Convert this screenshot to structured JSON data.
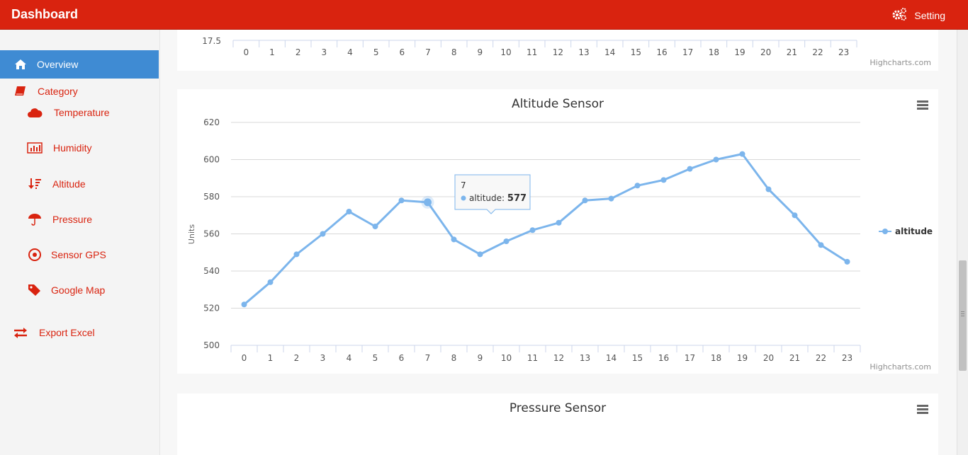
{
  "app": {
    "title": "Dashboard",
    "setting_label": "Setting"
  },
  "sidebar": {
    "items": [
      {
        "label": "Overview",
        "icon": "home-icon"
      },
      {
        "label": "Category",
        "icon": "book-icon"
      },
      {
        "label": "Temperature",
        "icon": "cloud-icon"
      },
      {
        "label": "Humidity",
        "icon": "bar-chart-icon"
      },
      {
        "label": "Altitude",
        "icon": "sort-icon"
      },
      {
        "label": "Pressure",
        "icon": "umbrella-icon"
      },
      {
        "label": "Sensor GPS",
        "icon": "target-icon"
      },
      {
        "label": "Google Map",
        "icon": "tag-icon"
      },
      {
        "label": "Export Excel",
        "icon": "exchange-icon"
      }
    ]
  },
  "top_chart": {
    "ytick": "17.5",
    "categories": [
      "0",
      "1",
      "2",
      "3",
      "4",
      "5",
      "6",
      "7",
      "8",
      "9",
      "10",
      "11",
      "12",
      "13",
      "14",
      "15",
      "16",
      "17",
      "18",
      "19",
      "20",
      "21",
      "22",
      "23"
    ],
    "credits": "Highcharts.com"
  },
  "altitude_chart": {
    "menu_icon": "hamburger-menu-icon",
    "credits": "Highcharts.com",
    "tooltip": {
      "x": "7",
      "series": "altitude",
      "value": "577"
    },
    "accent": "#7cb5ec"
  },
  "pressure_chart": {
    "title": "Pressure Sensor",
    "menu_icon": "hamburger-menu-icon"
  },
  "chart_data": {
    "type": "line",
    "title": "Altitude Sensor",
    "xlabel": "",
    "ylabel": "Units",
    "categories": [
      "0",
      "1",
      "2",
      "3",
      "4",
      "5",
      "6",
      "7",
      "8",
      "9",
      "10",
      "11",
      "12",
      "13",
      "14",
      "15",
      "16",
      "17",
      "18",
      "19",
      "20",
      "21",
      "22",
      "23"
    ],
    "yticks": [
      "500",
      "520",
      "540",
      "560",
      "580",
      "600",
      "620"
    ],
    "ylim": [
      500,
      620
    ],
    "grid": true,
    "legend": "right",
    "series": [
      {
        "name": "altitude",
        "values": [
          522,
          534,
          549,
          560,
          572,
          564,
          578,
          577,
          557,
          549,
          556,
          562,
          566,
          578,
          579,
          586,
          589,
          595,
          600,
          603,
          584,
          570,
          554,
          545
        ]
      }
    ]
  }
}
